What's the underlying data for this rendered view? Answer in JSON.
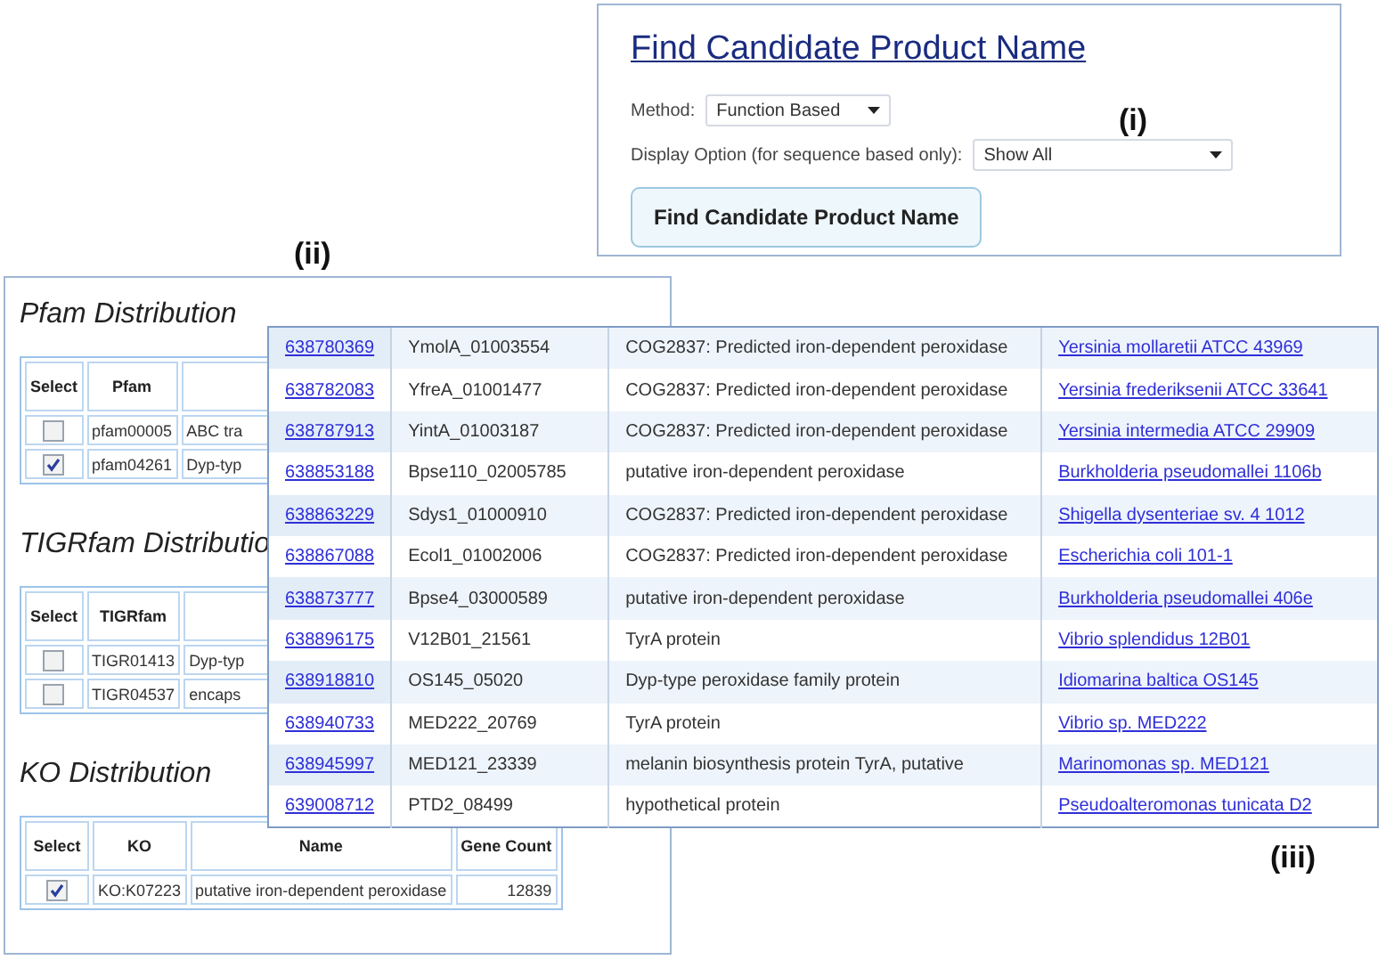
{
  "form_panel": {
    "label": "(i)",
    "title": "Find Candidate Product Name",
    "method_label": "Method:",
    "method_value": "Function Based",
    "display_option_label": "Display Option (for sequence based only):",
    "display_option_value": "Show All",
    "button": "Find Candidate Product Name"
  },
  "distribution_panel": {
    "label": "(ii)",
    "sections": [
      {
        "title": "Pfam Distribution",
        "columns": [
          "Select",
          "Pfam"
        ],
        "rows": [
          {
            "checked": false,
            "id": "pfam00005",
            "name": "ABC tra"
          },
          {
            "checked": true,
            "id": "pfam04261",
            "name": "Dyp-typ"
          }
        ]
      },
      {
        "title": "TIGRfam Distributio",
        "columns": [
          "Select",
          "TIGRfam"
        ],
        "rows": [
          {
            "checked": false,
            "id": "TIGR01413",
            "name": "Dyp-typ"
          },
          {
            "checked": false,
            "id": "TIGR04537",
            "name": "encaps"
          }
        ]
      },
      {
        "title": "KO Distribution",
        "columns": [
          "Select",
          "KO",
          "Name",
          "Gene Count"
        ],
        "rows": [
          {
            "checked": true,
            "id": "KO:K07223",
            "name": "putative iron-dependent peroxidase",
            "gene_count": "12839"
          }
        ]
      }
    ]
  },
  "genes_panel": {
    "label": "(iii)",
    "rows": [
      {
        "gene_id": "638780369",
        "locus_tag": "YmolA_01003554",
        "product": "COG2837: Predicted iron-dependent peroxidase",
        "genome": "Yersinia mollaretii ATCC 43969"
      },
      {
        "gene_id": "638782083",
        "locus_tag": "YfreA_01001477",
        "product": "COG2837: Predicted iron-dependent peroxidase",
        "genome": "Yersinia frederiksenii ATCC 33641"
      },
      {
        "gene_id": "638787913",
        "locus_tag": "YintA_01003187",
        "product": "COG2837: Predicted iron-dependent peroxidase",
        "genome": "Yersinia intermedia ATCC 29909"
      },
      {
        "gene_id": "638853188",
        "locus_tag": "Bpse110_02005785",
        "product": "putative iron-dependent peroxidase",
        "genome": "Burkholderia pseudomallei 1106b"
      },
      {
        "gene_id": "638863229",
        "locus_tag": "Sdys1_01000910",
        "product": "COG2837: Predicted iron-dependent peroxidase",
        "genome": "Shigella dysenteriae sv. 4 1012"
      },
      {
        "gene_id": "638867088",
        "locus_tag": "Ecol1_01002006",
        "product": "COG2837: Predicted iron-dependent peroxidase",
        "genome": "Escherichia coli 101-1"
      },
      {
        "gene_id": "638873777",
        "locus_tag": "Bpse4_03000589",
        "product": "putative iron-dependent peroxidase",
        "genome": "Burkholderia pseudomallei 406e"
      },
      {
        "gene_id": "638896175",
        "locus_tag": "V12B01_21561",
        "product": "TyrA protein",
        "genome": "Vibrio splendidus 12B01"
      },
      {
        "gene_id": "638918810",
        "locus_tag": "OS145_05020",
        "product": "Dyp-type peroxidase family protein",
        "genome": "Idiomarina baltica OS145"
      },
      {
        "gene_id": "638940733",
        "locus_tag": "MED222_20769",
        "product": "TyrA protein",
        "genome": "Vibrio sp. MED222"
      },
      {
        "gene_id": "638945997",
        "locus_tag": "MED121_23339",
        "product": "melanin biosynthesis protein TyrA, putative",
        "genome": "Marinomonas sp. MED121"
      },
      {
        "gene_id": "639008712",
        "locus_tag": "PTD2_08499",
        "product": "hypothetical protein",
        "genome": "Pseudoalteromonas tunicata D2"
      }
    ]
  }
}
